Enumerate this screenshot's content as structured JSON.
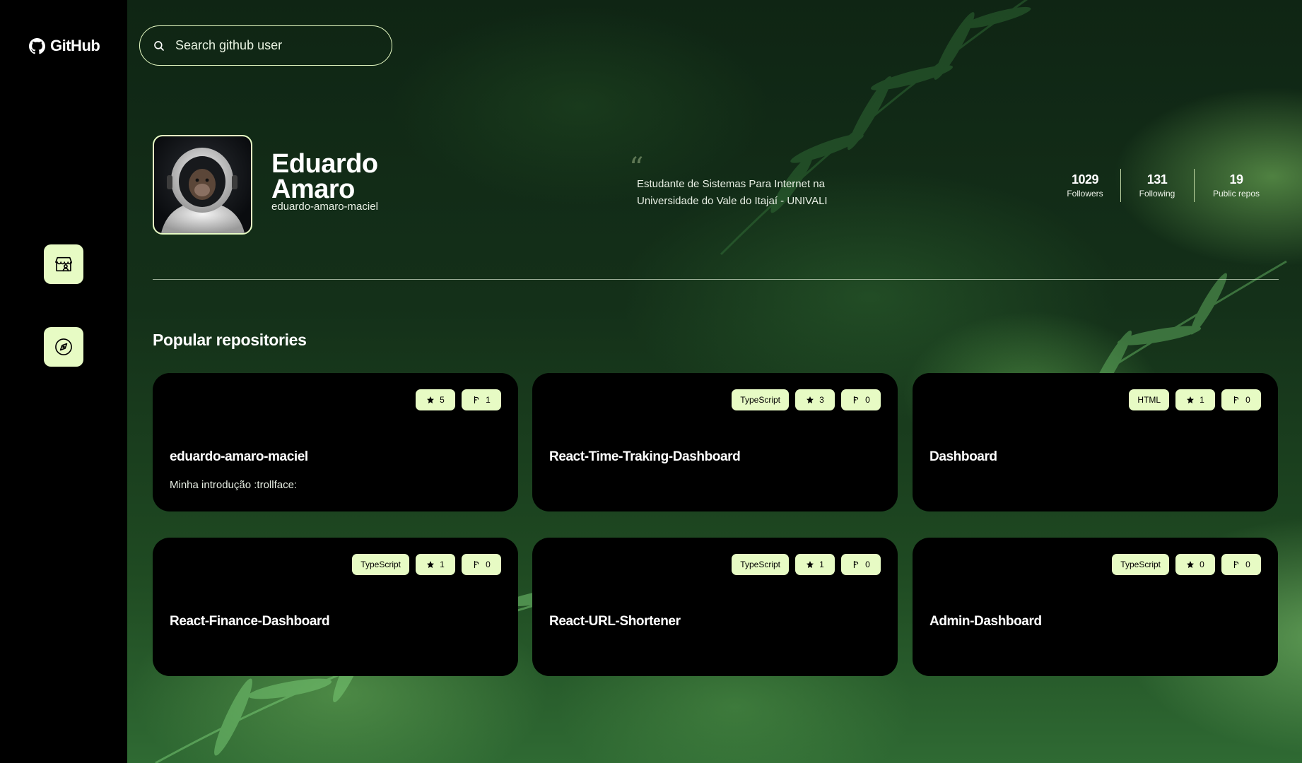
{
  "app": {
    "logo_text": "GitHub"
  },
  "search": {
    "placeholder": "Search github user"
  },
  "sidebar": {
    "items": [
      {
        "icon": "store-user-icon"
      },
      {
        "icon": "compass-icon"
      }
    ]
  },
  "profile": {
    "name": "Eduardo Amaro",
    "username": "eduardo-amaro-maciel",
    "bio": "Estudante de Sistemas Para Internet na Universidade do Vale do Itajaí - UNIVALI",
    "stats": [
      {
        "value": "1029",
        "label": "Followers"
      },
      {
        "value": "131",
        "label": "Following"
      },
      {
        "value": "19",
        "label": "Public repos"
      }
    ]
  },
  "repos_section": {
    "title": "Popular repositories"
  },
  "repos": [
    {
      "name": "eduardo-amaro-maciel",
      "description": "Minha introdução :trollface:",
      "language": "",
      "stars": "5",
      "forks": "1"
    },
    {
      "name": "React-Time-Traking-Dashboard",
      "description": "",
      "language": "TypeScript",
      "stars": "3",
      "forks": "0"
    },
    {
      "name": "Dashboard",
      "description": "",
      "language": "HTML",
      "stars": "1",
      "forks": "0"
    },
    {
      "name": "React-Finance-Dashboard",
      "description": "",
      "language": "TypeScript",
      "stars": "1",
      "forks": "0"
    },
    {
      "name": "React-URL-Shortener",
      "description": "",
      "language": "TypeScript",
      "stars": "1",
      "forks": "0"
    },
    {
      "name": "Admin-Dashboard",
      "description": "",
      "language": "TypeScript",
      "stars": "0",
      "forks": "0"
    }
  ],
  "colors": {
    "accent": "#e7fbc4",
    "sidebar": "#000000",
    "card": "#000000"
  }
}
